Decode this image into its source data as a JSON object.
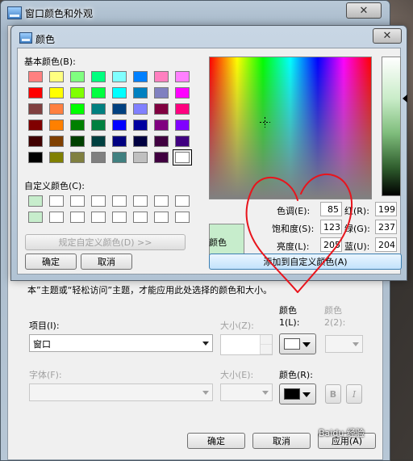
{
  "back_window": {
    "title": "窗口颜色和外观",
    "close_glyph": "✕",
    "note_text": "本”主题或“轻松访问”主题，才能应用此处选择的颜色和大小。",
    "item_label": "项目(I):",
    "item_value": "窗口",
    "size1_label": "大小(Z):",
    "color1_label": "颜色",
    "color1_sub": "1(L):",
    "color2_label": "颜色",
    "color2_sub": "2(2):",
    "font_label": "字体(F):",
    "size2_label": "大小(E):",
    "color_r_label": "颜色(R):",
    "bold_label": "B",
    "italic_label": "I",
    "buttons": {
      "ok": "确定",
      "cancel": "取消",
      "apply": "应用(A)"
    },
    "color1_value": "#ffffff",
    "font_color_value": "#000000"
  },
  "dialog": {
    "title": "颜色",
    "close_glyph": "✕",
    "basic_colors_label": "基本颜色(B):",
    "basic_colors": [
      "#ff8080",
      "#ffff80",
      "#80ff80",
      "#00ff80",
      "#80ffff",
      "#0080ff",
      "#ff80c0",
      "#ff80ff",
      "#ff0000",
      "#ffff00",
      "#80ff00",
      "#00ff40",
      "#00ffff",
      "#0080c0",
      "#8080c0",
      "#ff00ff",
      "#804040",
      "#ff8040",
      "#00ff00",
      "#008080",
      "#004080",
      "#8080ff",
      "#800040",
      "#ff0080",
      "#800000",
      "#ff8000",
      "#008000",
      "#008040",
      "#0000ff",
      "#0000a0",
      "#800080",
      "#8000ff",
      "#400000",
      "#804000",
      "#004000",
      "#004040",
      "#000080",
      "#000040",
      "#400040",
      "#400080",
      "#000000",
      "#808000",
      "#808040",
      "#808080",
      "#408080",
      "#c0c0c0",
      "#400040",
      "#ffffff"
    ],
    "selected_basic_index": 47,
    "custom_colors_label": "自定义颜色(C):",
    "custom_colors": [
      "#c7edcc",
      "#ffffff",
      "#ffffff",
      "#ffffff",
      "#ffffff",
      "#ffffff",
      "#ffffff",
      "#ffffff",
      "#c7edcc",
      "#ffffff",
      "#ffffff",
      "#ffffff",
      "#ffffff",
      "#ffffff",
      "#ffffff",
      "#ffffff"
    ],
    "define_custom_button": "规定自定义颜色(D) >>",
    "ok_button": "确定",
    "cancel_button": "取消",
    "preview_label": "颜色",
    "preview_color": "#c7edcc",
    "fields": {
      "hue_label": "色调(E):",
      "hue_value": "85",
      "sat_label": "饱和度(S):",
      "sat_value": "123",
      "lum_label": "亮度(L):",
      "lum_value": "205",
      "red_label": "红(R):",
      "red_value": "199",
      "green_label": "绿(G):",
      "green_value": "237",
      "blue_label": "蓝(U):",
      "blue_value": "204"
    },
    "add_custom_button": "添加到自定义颜色(A)"
  },
  "watermark": "Baidu 经验",
  "annotation_color": "#e8141c"
}
